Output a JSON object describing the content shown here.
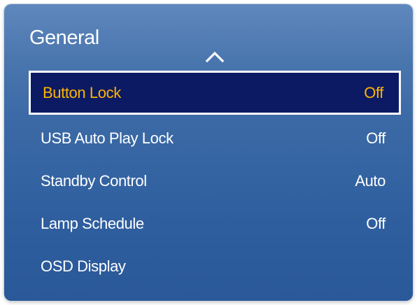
{
  "title": "General",
  "scroll_indicator_icon": "chevron-up-icon",
  "colors": {
    "selected_bg": "#0b1a63",
    "selected_text": "#ffb400",
    "text": "#ffffff"
  },
  "menu": {
    "selected_index": 0,
    "items": [
      {
        "label": "Button Lock",
        "value": "Off"
      },
      {
        "label": "USB Auto Play Lock",
        "value": "Off"
      },
      {
        "label": "Standby Control",
        "value": "Auto"
      },
      {
        "label": "Lamp Schedule",
        "value": "Off"
      },
      {
        "label": "OSD Display",
        "value": ""
      }
    ]
  }
}
